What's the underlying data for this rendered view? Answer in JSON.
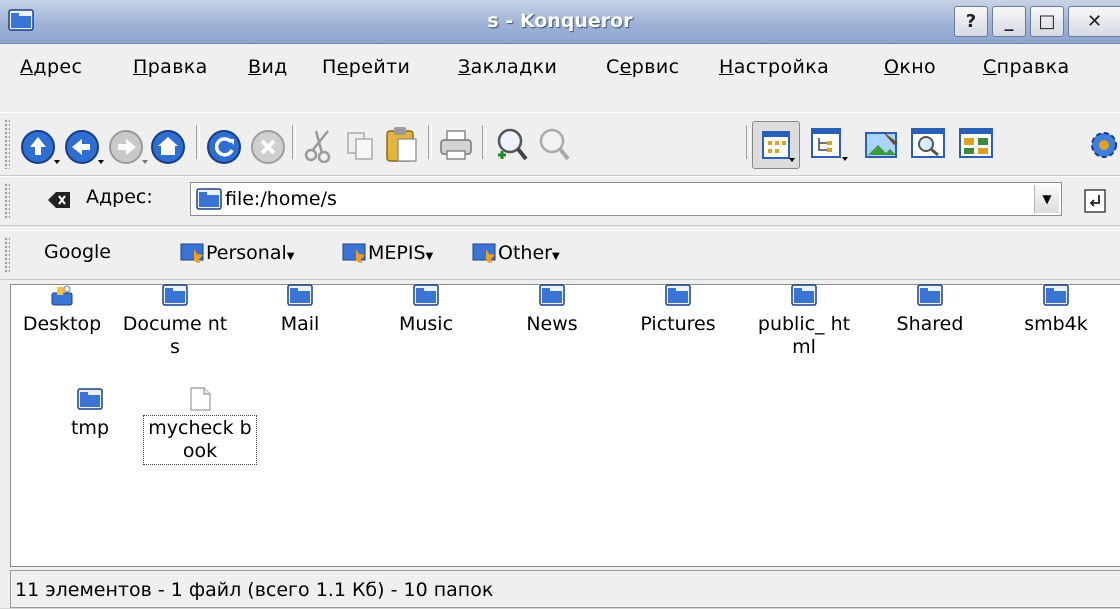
{
  "window": {
    "title": "s - Konqueror"
  },
  "titlebar_buttons": {
    "help": "?",
    "minimize": "_",
    "maximize": "□",
    "close": "✕"
  },
  "menu": [
    {
      "underline": "А",
      "rest": "дрес"
    },
    {
      "underline": "П",
      "rest": "равка"
    },
    {
      "underline": "В",
      "rest": "ид"
    },
    {
      "pre": "П",
      "underline": "е",
      "rest": "рейти"
    },
    {
      "underline": "З",
      "rest": "акладки"
    },
    {
      "pre": "С",
      "underline": "е",
      "rest": "рвис"
    },
    {
      "underline": "Н",
      "rest": "астройка"
    },
    {
      "underline": "О",
      "rest": "кно"
    },
    {
      "underline": "С",
      "rest": "правка"
    }
  ],
  "address": {
    "label_pre": "А",
    "label_u": "д",
    "label_rest": "рес:",
    "value": "file:/home/s"
  },
  "bookmarks": {
    "google": "Google",
    "personal": "Personal",
    "mepis": "MEPIS",
    "other": "Other"
  },
  "files": [
    {
      "name": "Desktop",
      "icon": "desktop-icon"
    },
    {
      "name": "Documents",
      "display": "Docume nts",
      "icon": "folder-icon"
    },
    {
      "name": "Mail",
      "icon": "folder-icon"
    },
    {
      "name": "Music",
      "icon": "folder-icon"
    },
    {
      "name": "News",
      "icon": "folder-icon"
    },
    {
      "name": "Pictures",
      "icon": "folder-icon"
    },
    {
      "name": "public_html",
      "display": "public_ html",
      "icon": "folder-icon"
    },
    {
      "name": "Shared",
      "icon": "folder-icon"
    },
    {
      "name": "smb4k",
      "icon": "folder-icon"
    },
    {
      "name": "tmp",
      "icon": "folder-icon"
    },
    {
      "name": "mycheckbook",
      "display": "mycheck book",
      "icon": "file-icon",
      "selected": true
    }
  ],
  "status": {
    "text": "11 элементов - 1 файл (всего 1.1 Кб) - 10 папок"
  },
  "colors": {
    "titlebar": "#9fb3d6",
    "folder": "#3a74d4",
    "accent": "#2a5fb8"
  }
}
